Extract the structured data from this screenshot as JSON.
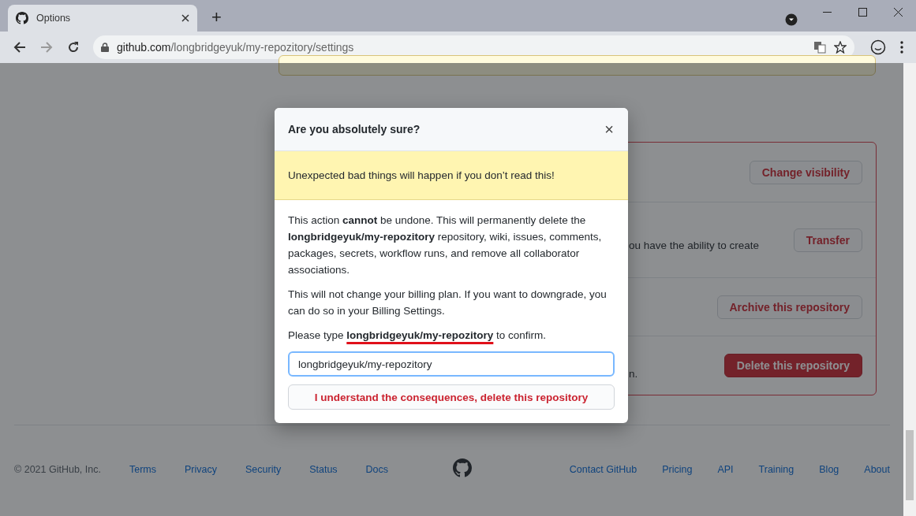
{
  "browser": {
    "tab_title": "Options",
    "new_tab": "+",
    "address_host": "github.com",
    "address_path": "/longbridgeyuk/my-repozitory/settings"
  },
  "danger_zone": {
    "rows": [
      {
        "button": "Change visibility",
        "kind": "normal"
      },
      {
        "text": "ou have the ability to create",
        "button": "Transfer",
        "kind": "normal"
      },
      {
        "button": "Archive this repository",
        "kind": "normal"
      },
      {
        "text": "n.",
        "button": "Delete this repository",
        "kind": "danger"
      }
    ]
  },
  "footer": {
    "copyright": "© 2021 GitHub, Inc.",
    "links_left": [
      "Terms",
      "Privacy",
      "Security",
      "Status",
      "Docs"
    ],
    "links_right": [
      "Contact GitHub",
      "Pricing",
      "API",
      "Training",
      "Blog",
      "About"
    ]
  },
  "modal": {
    "title": "Are you absolutely sure?",
    "close": "×",
    "warning": "Unexpected bad things will happen if you don’t read this!",
    "paragraphs": [
      "This action **cannot** be undone. This will permanently delete the **longbridgeyuk/my-repozitory** repository, wiki, issues, comments, packages, secrets, workflow runs, and remove all collaborator associations.",
      "This will not change your billing plan. If you want to downgrade, you can do so in your Billing Settings."
    ],
    "confirm_prompt": "Please type **longbridgeyuk/my-repozitory** to confirm.",
    "input_value": "longbridgeyuk/my-repozitory",
    "confirm_button": "I understand the consequences, delete this repository"
  }
}
